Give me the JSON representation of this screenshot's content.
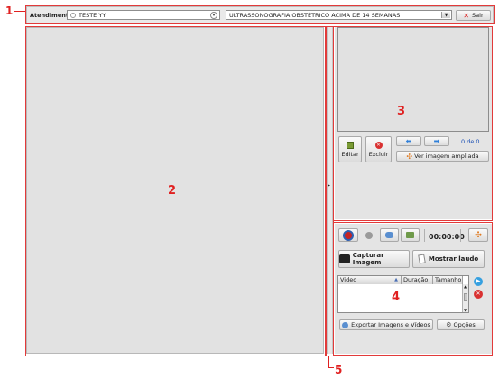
{
  "topbar": {
    "atendimento_label": "Atendimento",
    "patient_name": "TESTE YY",
    "exam_select_value": "ULTRASSONOGRAFIA OBSTÉTRICO ACIMA DE 14 SEMANAS",
    "exit_label": "Sair"
  },
  "image_panel": {
    "edit_label": "Editar",
    "delete_label": "Excluir",
    "counter": "0 de 0",
    "view_enlarged_label": "Ver imagem ampliada"
  },
  "video_panel": {
    "timer": "00:00:00",
    "capture_label": "Capturar Imagem",
    "show_report_label": "Mostrar laudo",
    "table_headers": [
      "Video",
      "Duração",
      "Tamanho"
    ],
    "export_label": "Exportar Imagens e Vídeos",
    "options_label": "Opções"
  },
  "callouts": [
    "1",
    "2",
    "3",
    "4",
    "5"
  ],
  "colors": {
    "annotation_red": "#e02020",
    "panel_gray": "#e4e4e4",
    "counter_blue": "#1a4fb5",
    "arrow_blue": "#2f7fd8"
  }
}
